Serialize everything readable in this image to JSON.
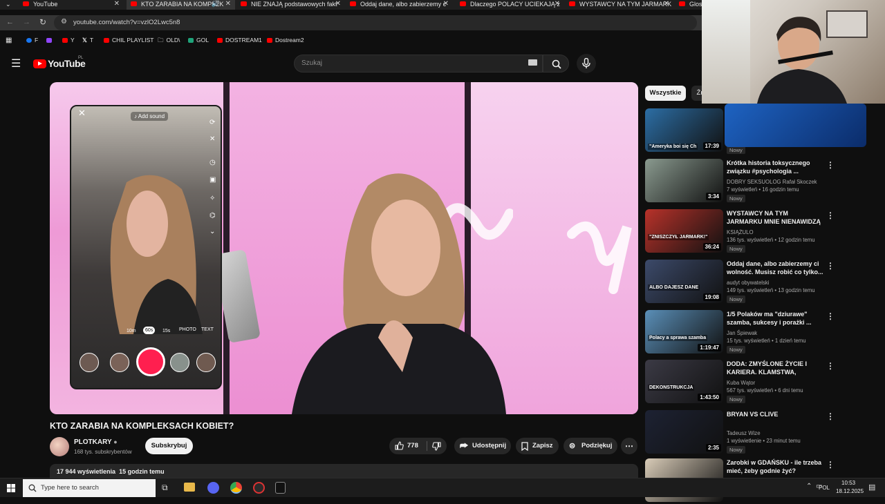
{
  "browser": {
    "tabs": [
      {
        "label": "YouTube",
        "active": false
      },
      {
        "label": "KTO ZARABIA NA KOMPLEK",
        "active": true
      },
      {
        "label": "NIE ZNAJĄ podstawowych fakt",
        "active": false
      },
      {
        "label": "Oddaj dane, albo zabierzemy c",
        "active": false
      },
      {
        "label": "Dlaczego POLACY UCIEKAJĄ z",
        "active": false
      },
      {
        "label": "WYSTAWCY NA TYM JARMARK",
        "active": false
      },
      {
        "label": "Glos",
        "active": false
      }
    ],
    "url": "youtube.com/watch?v=vzlO2Lwc5n8",
    "bookmarks": [
      {
        "label": "F",
        "color": "#1877f2"
      },
      {
        "label": "",
        "color": "#9146ff"
      },
      {
        "label": "Y",
        "color": "#ff0000"
      },
      {
        "label": "T",
        "color": "#ffffff"
      },
      {
        "label": "CHIL PLAYLIST",
        "color": "#ff0000"
      },
      {
        "label": "OLD\\",
        "color": "#c8c8c8"
      },
      {
        "label": "GOL",
        "color": "#1fa37a"
      },
      {
        "label": "DOSTREAM1",
        "color": "#ff0000"
      },
      {
        "label": "Dostream2",
        "color": "#ff0000"
      }
    ]
  },
  "youtube": {
    "logo": "YouTube",
    "logo_region": "PL",
    "search_placeholder": "Szukaj"
  },
  "video": {
    "phone_overlay": {
      "add_sound": "Add sound",
      "durations": [
        "10m",
        "60s",
        "15s",
        "PHOTO",
        "TEXT"
      ]
    },
    "title": "KTO ZARABIA NA KOMPLEKSACH KOBIET?",
    "channel": "PLOTKARY",
    "subscribers": "168 tys. subskrybentów",
    "subscribe_label": "Subskrybuj",
    "likes": "778",
    "share_label": "Udostępnij",
    "save_label": "Zapisz",
    "thanks_label": "Podziękuj",
    "views": "17 944 wyświetlenia",
    "posted": "15 godzin temu"
  },
  "sidebar": {
    "chips": [
      {
        "label": "Wszystkie"
      },
      {
        "label": "Źr"
      }
    ],
    "recommendations": [
      {
        "title": "",
        "channel": "",
        "meta": "",
        "badge": "Nowy",
        "duration": "17:39",
        "thumb_text": "\"Ameryka boi się Ch",
        "thumb_color": "#2c6ea5"
      },
      {
        "title": "Krótka historia toksycznego związku #psychologia ...",
        "channel": "DOBRY SEKSUOLOG Rafał Skoczek",
        "meta": "7 wyświetleń • 16 godzin temu",
        "badge": "Nowy",
        "duration": "3:34",
        "thumb_text": "",
        "thumb_color": "#8a9a8f"
      },
      {
        "title": "WYSTAWCY NA TYM JARMARKU MNIE NIENAWIDZĄ",
        "channel": "KSIĄŻULO",
        "meta": "136 tys. wyświetleń • 12 godzin temu",
        "badge": "Nowy",
        "duration": "36:24",
        "thumb_text": "\"ZNISZCZYŁ JARMARK!\"",
        "thumb_color": "#b8322a"
      },
      {
        "title": "Oddaj dane, albo zabierzemy ci wolność. Musisz robić co tylko...",
        "channel": "audyt obywatelski",
        "meta": "149 tys. wyświetleń • 13 godzin temu",
        "badge": "Nowy",
        "duration": "19:08",
        "thumb_text": "ALBO DAJESZ DANE",
        "thumb_color": "#3c4a6a"
      },
      {
        "title": "1/5 Polaków ma \"dziurawe\" szamba, sukcesy i porażki ...",
        "channel": "Jan Śpiewak",
        "meta": "15 tys. wyświetleń • 1 dzień temu",
        "badge": "Nowy",
        "duration": "1:19:47",
        "thumb_text": "Polacy a sprawa szamba",
        "thumb_color": "#5a8fb8"
      },
      {
        "title": "DODA: ZMYŚLONE ŻYCIE I KARIERA. KLAMSTWA, AFERY,...",
        "channel": "Kuba Wątor",
        "meta": "567 tys. wyświetleń • 6 dni temu",
        "badge": "Nowy",
        "duration": "1:43:50",
        "thumb_text": "DEKONSTRUKCJA",
        "thumb_color": "#3b3a45"
      },
      {
        "title": "BRYAN VS CLIVE",
        "channel": "Tadeusz Wize",
        "meta": "1 wyświetlenie • 23 minut temu",
        "badge": "Nowy",
        "duration": "2:35",
        "thumb_text": "",
        "thumb_color": "#1d2233"
      },
      {
        "title": "Zarobki w GDAŃSKU - ile trzeba mieć, żeby godnie żyć?",
        "channel": "",
        "meta": "",
        "badge": "",
        "duration": "",
        "thumb_text": "ILE",
        "thumb_color": "#d9ccb8"
      }
    ]
  },
  "taskbar": {
    "search_placeholder": "Type here to search",
    "language": "POL",
    "time": "10:53",
    "date": "18.12.2025"
  }
}
